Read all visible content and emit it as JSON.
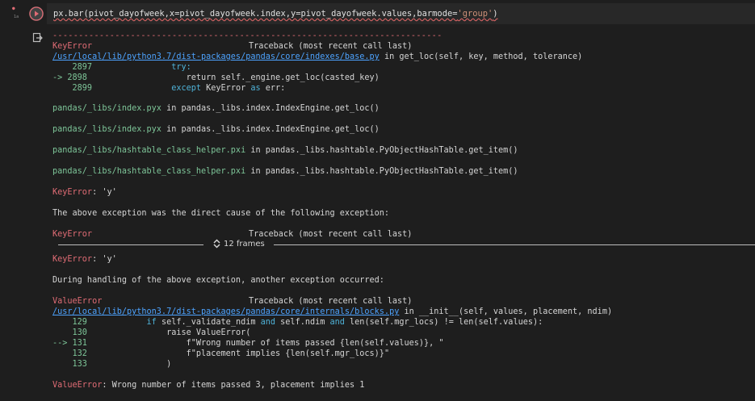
{
  "cell": {
    "execution_count": "1a",
    "code": {
      "prefix": "px.bar(pivot_dayofweek,x=pivot_dayofweek.index,y=pivot_dayofweek.values,barmode=",
      "string": "'group'",
      "suffix": ")"
    }
  },
  "output": {
    "dashes": "---------------------------------------------------------------------------",
    "tb1": {
      "error": "KeyError",
      "header": "Traceback (most recent call last)",
      "file": "/usr/local/lib/python3.7/dist-packages/pandas/core/indexes/base.py",
      "in_fn": " in get_loc(self, key, method, tolerance)",
      "l2897_num": "    2897",
      "l2897_code": "                try:",
      "l2898_arrow": "-> 2898",
      "l2898_code": "                    return self._engine.get_loc(casted_key)",
      "l2899_num": "    2899",
      "l2899_code_kw": "                except",
      "l2899_code_rest": " KeyError ",
      "l2899_code_as": "as",
      "l2899_code_err": " err:",
      "frame1_file": "pandas/_libs/index.pyx",
      "frame1_rest": " in pandas._libs.index.IndexEngine.get_loc()",
      "frame2_file": "pandas/_libs/index.pyx",
      "frame2_rest": " in pandas._libs.index.IndexEngine.get_loc()",
      "frame3_file": "pandas/_libs/hashtable_class_helper.pxi",
      "frame3_rest": " in pandas._libs.hashtable.PyObjectHashTable.get_item()",
      "frame4_file": "pandas/_libs/hashtable_class_helper.pxi",
      "frame4_rest": " in pandas._libs.hashtable.PyObjectHashTable.get_item()",
      "final_error": "KeyError",
      "final_msg": ": 'y'"
    },
    "cause_msg": "The above exception was the direct cause of the following exception:",
    "tb2": {
      "error": "KeyError",
      "header": "Traceback (most recent call last)",
      "frames_label": "12 frames",
      "final_error": "KeyError",
      "final_msg": ": 'y'"
    },
    "during_msg": "During handling of the above exception, another exception occurred:",
    "tb3": {
      "error": "ValueError",
      "header": "Traceback (most recent call last)",
      "file": "/usr/local/lib/python3.7/dist-packages/pandas/core/internals/blocks.py",
      "in_fn": " in __init__(self, values, placement, ndim)",
      "l129_num": "    129",
      "l129_kw": "            if",
      "l129_mid1": " self._validate_ndim ",
      "l129_and1": "and",
      "l129_mid2": " self.ndim ",
      "l129_and2": "and",
      "l129_rest": " len(self.mgr_locs) != len(self.values):",
      "l130_num": "    130",
      "l130_code": "                raise ValueError(",
      "l131_arrow": "--> 131",
      "l131_code": "                    f\"Wrong number of items passed {len(self.values)}, \"",
      "l132_num": "    132",
      "l132_code": "                    f\"placement implies {len(self.mgr_locs)}\"",
      "l133_num": "    133",
      "l133_code": "                )",
      "final_error": "ValueError",
      "final_msg": ": Wrong number of items passed 3, placement implies 1"
    }
  }
}
